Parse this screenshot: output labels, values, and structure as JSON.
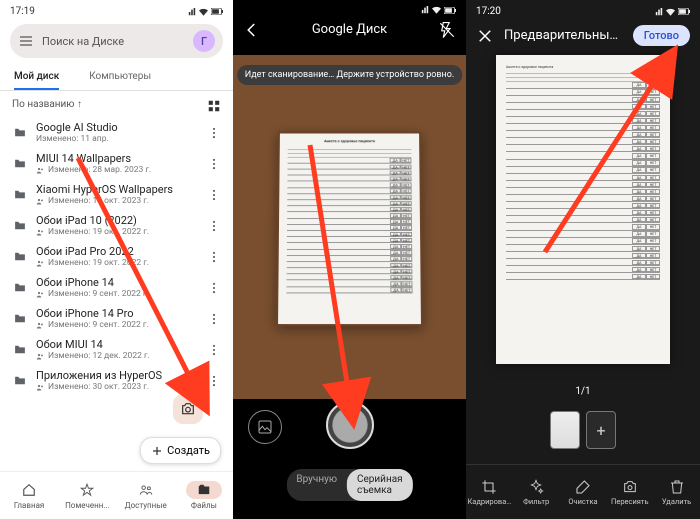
{
  "pane1": {
    "status_time": "17:19",
    "search_placeholder": "Поиск на Диске",
    "avatar_letter": "Г",
    "tabs": [
      "Мой диск",
      "Компьютеры"
    ],
    "sort_label": "По названию ↑",
    "folders": [
      {
        "name": "Google AI Studio",
        "sub": "Изменено: 11 апр.",
        "shared": false
      },
      {
        "name": "MIUI 14 Wallpapers",
        "sub": "Изменено: 28 мар. 2023 г.",
        "shared": true
      },
      {
        "name": "Xiaomi HyperOS Wallpapers",
        "sub": "Изменено: 18 окт. 2023 г.",
        "shared": true
      },
      {
        "name": "Обои iPad 10 (2022)",
        "sub": "Изменено: 19 окт. 2022 г.",
        "shared": true
      },
      {
        "name": "Обои iPad Pro 2022",
        "sub": "Изменено: 19 окт. 2022 г.",
        "shared": true
      },
      {
        "name": "Обои iPhone 14",
        "sub": "Изменено: 9 сент. 2022 г.",
        "shared": true
      },
      {
        "name": "Обои iPhone 14 Pro",
        "sub": "Изменено: 9 сент. 2022 г.",
        "shared": true
      },
      {
        "name": "Обои MIUI 14",
        "sub": "Изменено: 12 дек. 2022 г.",
        "shared": true
      },
      {
        "name": "Приложения из HyperOS",
        "sub": "Изменено: 30 окт. 2023 г.",
        "shared": true
      }
    ],
    "create_label": "Создать",
    "nav": [
      "Главная",
      "Помеченн...",
      "Доступные",
      "Файлы"
    ]
  },
  "pane2": {
    "title": "Google Диск",
    "toast": "Идет сканирование… Держите устройство ровно.",
    "modes": {
      "manual": "Вручную",
      "auto": "Серийная съемка"
    }
  },
  "pane3": {
    "status_time": "17:20",
    "title": "Предварительный п…",
    "done_label": "Готово",
    "page_count": "1/1",
    "tools": [
      "Кадрирова…",
      "Фильтр",
      "Очистка",
      "Пересиять",
      "Удалить"
    ]
  }
}
